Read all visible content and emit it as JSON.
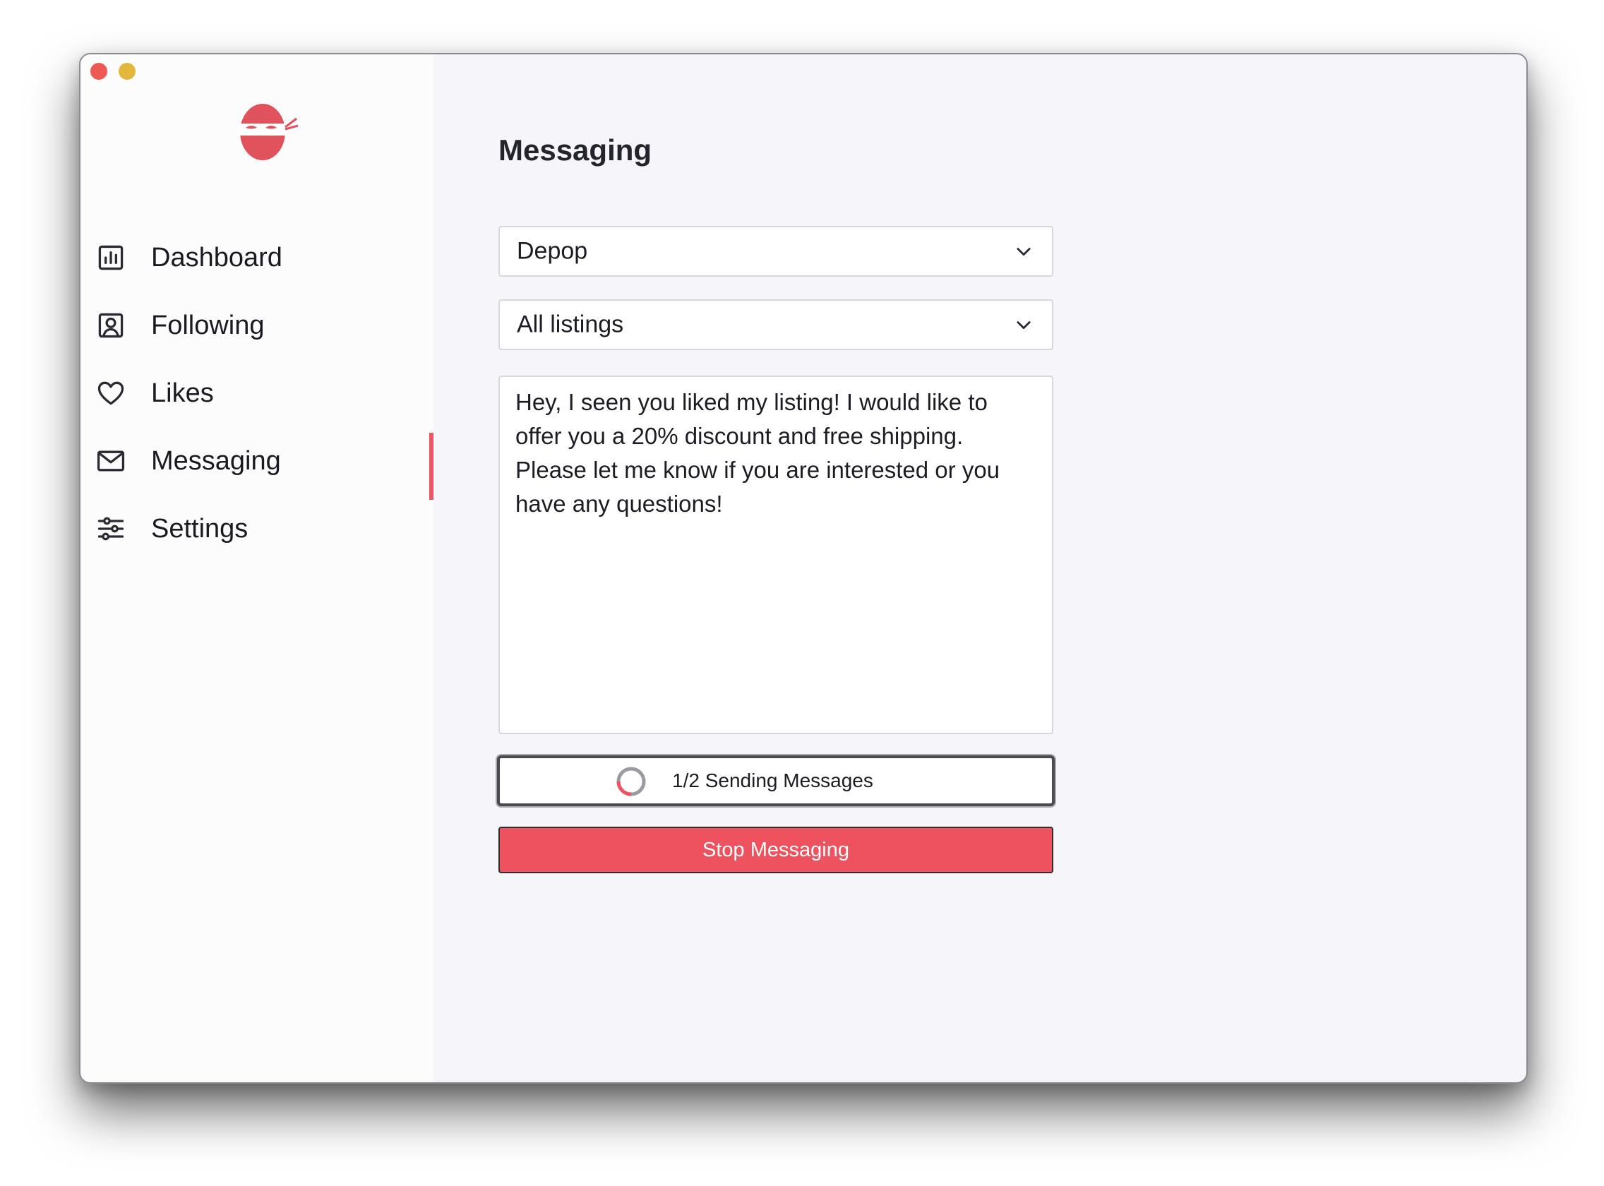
{
  "sidebar": {
    "logo_icon": "ninja-logo",
    "items": [
      {
        "label": "Dashboard",
        "icon": "bar-chart-icon"
      },
      {
        "label": "Following",
        "icon": "user-square-icon"
      },
      {
        "label": "Likes",
        "icon": "heart-icon"
      },
      {
        "label": "Messaging",
        "icon": "mail-icon",
        "active": true
      },
      {
        "label": "Settings",
        "icon": "sliders-icon"
      }
    ]
  },
  "main": {
    "title": "Messaging",
    "platform_select": {
      "value": "Depop"
    },
    "listing_select": {
      "value": "All listings"
    },
    "message": "Hey, I seen you liked my listing! I would like to offer you a 20% discount and free shipping. Please let me know if you are interested or you have any questions!",
    "status": {
      "text": "1/2 Sending Messages",
      "progress": 0.5
    },
    "stop_button": "Stop Messaging"
  },
  "colors": {
    "accent": "#ee525e",
    "sidebar_bg": "#fcfcfd",
    "content_bg": "#f5f5fa"
  }
}
